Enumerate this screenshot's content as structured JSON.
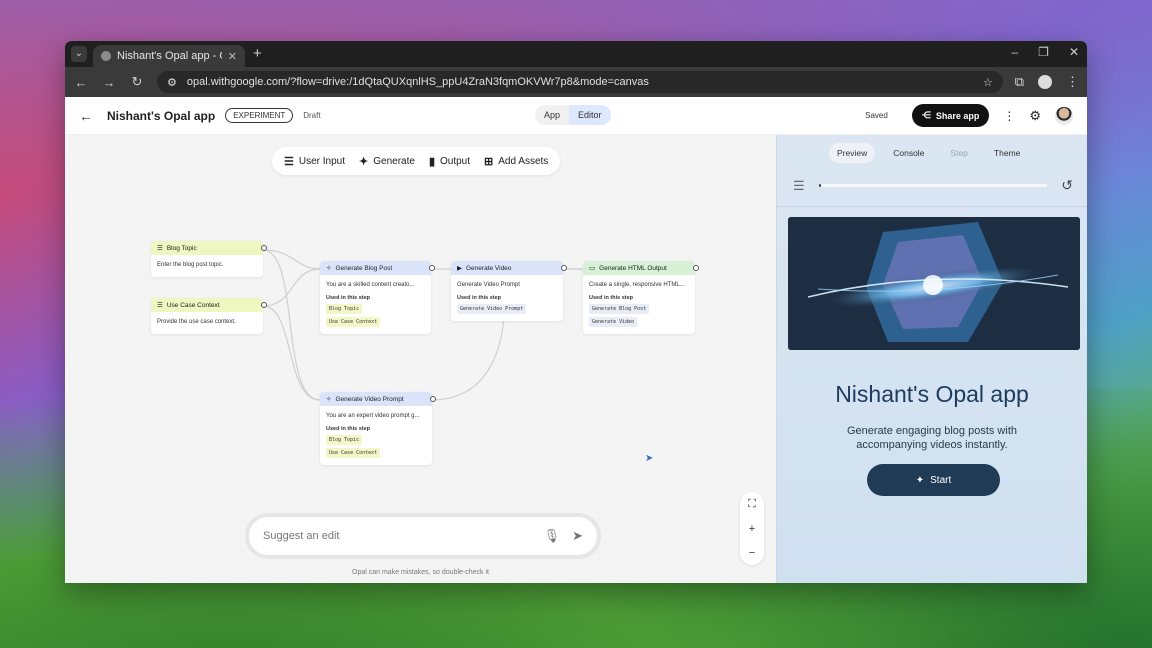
{
  "browser": {
    "tab_title": "Nishant's Opal app - Opal [Exp...",
    "new_tab": "+",
    "url": "opal.withgoogle.com/?flow=drive:/1dQtaQUXqnlHS_ppU4ZraN3fqmOKVWr7p8&mode=canvas"
  },
  "header": {
    "title": "Nishant's Opal app",
    "experiment_badge": "EXPERIMENT",
    "draft": "Draft",
    "mode_app": "App",
    "mode_editor": "Editor",
    "saved": "Saved",
    "share": "Share app"
  },
  "canvas_toolbar": {
    "user_input": "User Input",
    "generate": "Generate",
    "output": "Output",
    "add_assets": "Add Assets"
  },
  "nodes": {
    "blog_topic": {
      "title": "Blog Topic",
      "body": "Enter the blog post topic."
    },
    "use_case": {
      "title": "Use Case Context",
      "body": "Provide the use case context."
    },
    "gen_blog": {
      "title": "Generate Blog Post",
      "body": "You are a skilled content creato...",
      "used": "Used in this step",
      "chips": [
        "Blog Topic",
        "Use Case Context"
      ]
    },
    "gen_video": {
      "title": "Generate Video",
      "body": "Generate Video Prompt",
      "used": "Used in this step",
      "chips": [
        "Generate Video Prompt"
      ]
    },
    "gen_html": {
      "title": "Generate HTML Output",
      "body": "Create a single, responsive HTML...",
      "used": "Used in this step",
      "chips": [
        "Generate Blog Post",
        "Generate Video"
      ]
    },
    "gen_prompt": {
      "title": "Generate Video Prompt",
      "body": "You are an expert video prompt g...",
      "used": "Used in this step",
      "chips": [
        "Blog Topic",
        "Use Case Context"
      ]
    }
  },
  "suggest": {
    "placeholder": "Suggest an edit",
    "disclaimer": "Opal can make mistakes, so double-check it"
  },
  "panel": {
    "tabs": [
      "Preview",
      "Console",
      "Step",
      "Theme"
    ],
    "app_name": "Nishant's Opal app",
    "description": "Generate engaging blog posts with accompanying videos instantly.",
    "start": "Start",
    "progress": 0.01
  },
  "colors": {
    "share_bg": "#111111",
    "start_bg": "#1f3b55",
    "node_yellow": "#eef7c0",
    "node_blue": "#d9e4fa",
    "node_green": "#d7f0d6"
  }
}
